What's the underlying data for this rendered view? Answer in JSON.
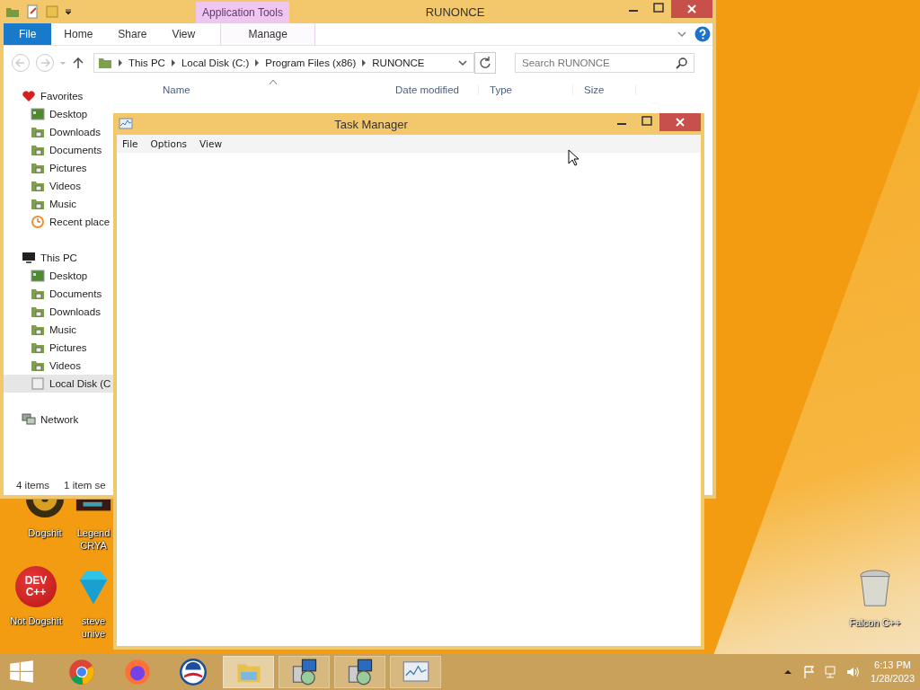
{
  "explorer": {
    "title": "RUNONCE",
    "contextual_group": "Application Tools",
    "ribbon_tabs": [
      {
        "label": "File",
        "kind": "file"
      },
      {
        "label": "Home",
        "kind": "tab"
      },
      {
        "label": "Share",
        "kind": "tab"
      },
      {
        "label": "View",
        "kind": "tab"
      },
      {
        "label": "Manage",
        "kind": "contextual"
      }
    ],
    "breadcrumb": [
      "This PC",
      "Local Disk (C:)",
      "Program Files (x86)",
      "RUNONCE"
    ],
    "search": {
      "placeholder": "Search RUNONCE"
    },
    "columns": [
      "Name",
      "Date modified",
      "Type",
      "Size"
    ],
    "nav": [
      {
        "label": "Favorites",
        "kind": "favorites",
        "selected": false,
        "children": [
          {
            "label": "Desktop",
            "kind": "desktop",
            "selected": false
          },
          {
            "label": "Downloads",
            "kind": "folder",
            "selected": false
          },
          {
            "label": "Documents",
            "kind": "folder",
            "selected": false
          },
          {
            "label": "Pictures",
            "kind": "folder",
            "selected": false
          },
          {
            "label": "Videos",
            "kind": "folder",
            "selected": false
          },
          {
            "label": "Music",
            "kind": "folder",
            "selected": false
          },
          {
            "label": "Recent place",
            "kind": "recent",
            "selected": false
          }
        ]
      },
      {
        "label": "This PC",
        "kind": "pc",
        "selected": false,
        "children": [
          {
            "label": "Desktop",
            "kind": "desktop",
            "selected": false
          },
          {
            "label": "Documents",
            "kind": "folder",
            "selected": false
          },
          {
            "label": "Downloads",
            "kind": "folder",
            "selected": false
          },
          {
            "label": "Music",
            "kind": "folder",
            "selected": false
          },
          {
            "label": "Pictures",
            "kind": "folder",
            "selected": false
          },
          {
            "label": "Videos",
            "kind": "folder",
            "selected": false
          },
          {
            "label": "Local Disk (C",
            "kind": "disk",
            "selected": true
          }
        ]
      },
      {
        "label": "Network",
        "kind": "network",
        "selected": false
      }
    ],
    "status": [
      "4 items",
      "1 item se"
    ]
  },
  "task_manager": {
    "title": "Task Manager",
    "menu": [
      "File",
      "Options",
      "View"
    ]
  },
  "desktop_icons": [
    {
      "lines": [
        "Dogshit"
      ],
      "kind": "disc"
    },
    {
      "lines": [
        "Legend",
        "CRYA"
      ],
      "kind": "game"
    },
    {
      "lines": [
        "Not Dogshit"
      ],
      "kind": "dev",
      "logo_text": "DEV C++"
    },
    {
      "lines": [
        "steve",
        "unive"
      ],
      "kind": "gem"
    },
    {
      "lines": [
        "Falcon C++"
      ],
      "kind": "bin"
    }
  ],
  "taskbar": {
    "apps": [
      {
        "kind": "chrome",
        "running": false,
        "selected": false
      },
      {
        "kind": "firefox",
        "running": false,
        "selected": false
      },
      {
        "kind": "emblem",
        "running": false,
        "selected": false
      },
      {
        "kind": "folder",
        "running": true,
        "selected": true
      },
      {
        "kind": "setup",
        "running": true,
        "selected": false
      },
      {
        "kind": "setup",
        "running": true,
        "selected": false
      },
      {
        "kind": "monitor",
        "running": true,
        "selected": false
      }
    ],
    "time": "6:13 PM",
    "date": "1/28/2023"
  }
}
